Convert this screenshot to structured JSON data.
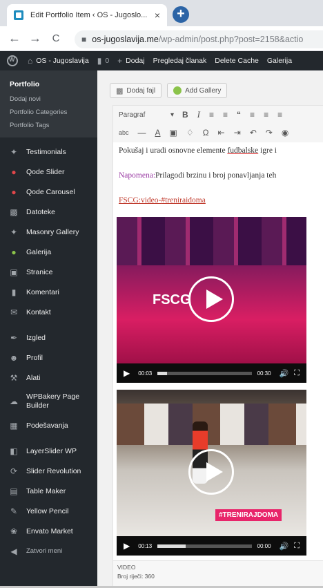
{
  "browser": {
    "tab_title": "Edit Portfolio Item ‹ OS - Jugoslo...",
    "tab_close": "×",
    "new_tab": "+",
    "back": "←",
    "forward": "→",
    "reload": "C",
    "url_host": "os-jugoslavija.me",
    "url_path": "/wp-admin/post.php?post=2158&actio"
  },
  "adminbar": {
    "site_name": "OS - Jugoslavija",
    "comments_count": "0",
    "add_new": "Dodaj",
    "view_post": "Pregledaj članak",
    "delete_cache": "Delete Cache",
    "gallery": "Galerija"
  },
  "sidebar": {
    "submenu": {
      "head": "Portfolio",
      "items": [
        "Dodaj novi",
        "Portfolio Categories",
        "Portfolio Tags"
      ]
    },
    "items": [
      {
        "label": "Testimonials",
        "icon": "pin-icon"
      },
      {
        "label": "Qode Slider",
        "icon": "qode-icon"
      },
      {
        "label": "Qode Carousel",
        "icon": "qode-icon"
      },
      {
        "label": "Datoteke",
        "icon": "media-icon"
      },
      {
        "label": "Masonry Gallery",
        "icon": "pin-icon"
      },
      {
        "label": "Galerija",
        "icon": "gallery-icon"
      },
      {
        "label": "Stranice",
        "icon": "pages-icon"
      },
      {
        "label": "Komentari",
        "icon": "comments-icon"
      },
      {
        "label": "Kontakt",
        "icon": "mail-icon"
      },
      {
        "label": "Izgled",
        "icon": "brush-icon"
      },
      {
        "label": "Profil",
        "icon": "user-icon"
      },
      {
        "label": "Alati",
        "icon": "wrench-icon"
      },
      {
        "label": "WPBakery Page Builder",
        "icon": "cloud-icon"
      },
      {
        "label": "Podešavanja",
        "icon": "settings-icon"
      },
      {
        "label": "LayerSlider WP",
        "icon": "layers-icon"
      },
      {
        "label": "Slider Revolution",
        "icon": "refresh-icon"
      },
      {
        "label": "Table Maker",
        "icon": "table-icon"
      },
      {
        "label": "Yellow Pencil",
        "icon": "pencil-icon"
      },
      {
        "label": "Envato Market",
        "icon": "leaf-icon"
      },
      {
        "label": "Zatvori meni",
        "icon": "collapse-icon"
      }
    ]
  },
  "content": {
    "add_media": "Dodaj fajl",
    "add_gallery": "Add Gallery",
    "format_select": "Paragraf",
    "text1": "Pokušaj i uradi osnovne elemente ",
    "text1_ul": "fudbalske",
    "text1_end": " igre i",
    "note_label": "Napomena:",
    "note_text": "Prilagodi brzinu i broj ponavljanja teh",
    "link_text": "FSCG:video-",
    "link_tag": "#treniraidoma",
    "video1": {
      "current": "00:03",
      "duration": "00:30",
      "progress": 0.1
    },
    "video2": {
      "current": "00:13",
      "duration": "00:00",
      "progress": 0.3
    },
    "video1_overlay": "FSCG",
    "video2_overlay": "#TRENIRAJDOMA",
    "status_path": "VIDEO",
    "word_count": "Broj riječi: 360"
  },
  "colors": {
    "admin_bg": "#23282d",
    "submenu_bg": "#32373c",
    "accent_red": "#e0464a",
    "note_purple": "#9a3aa3"
  }
}
